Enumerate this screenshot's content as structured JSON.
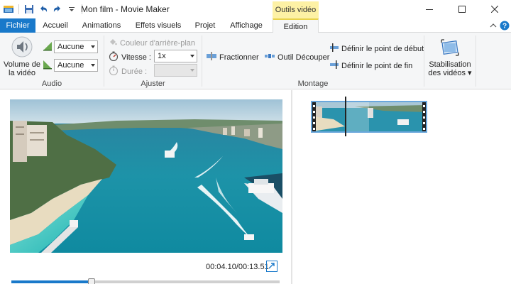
{
  "titlebar": {
    "title": "Mon film - Movie Maker",
    "context_header": "Outils vidéo"
  },
  "tabs": [
    {
      "label": "Fichier"
    },
    {
      "label": "Accueil"
    },
    {
      "label": "Animations"
    },
    {
      "label": "Effets visuels"
    },
    {
      "label": "Projet"
    },
    {
      "label": "Affichage"
    },
    {
      "label": "Edition"
    }
  ],
  "ribbon": {
    "audio": {
      "label": "Audio",
      "volume_label_1": "Volume de",
      "volume_label_2": "la vidéo",
      "fade_in_value": "Aucune",
      "fade_out_value": "Aucune"
    },
    "ajuster": {
      "label": "Ajuster",
      "bg_color_label": "Couleur d'arrière-plan",
      "speed_label": "Vitesse :",
      "speed_value": "1x",
      "duration_label": "Durée :",
      "duration_value": ""
    },
    "montage": {
      "label": "Montage",
      "split_label": "Fractionner",
      "trim_label": "Outil Découper",
      "set_start_label": "Définir le point de début",
      "set_end_label": "Définir le point de fin"
    },
    "stabilisation": {
      "label_1": "Stabilisation",
      "label_2": "des vidéos"
    }
  },
  "preview": {
    "timecode": "00:04.10/00:13.51",
    "progress": 0.3
  },
  "colors": {
    "accent": "#1979ca",
    "context_tab": "#fdf1a5",
    "ribbon_bg": "#f5f6f7"
  }
}
